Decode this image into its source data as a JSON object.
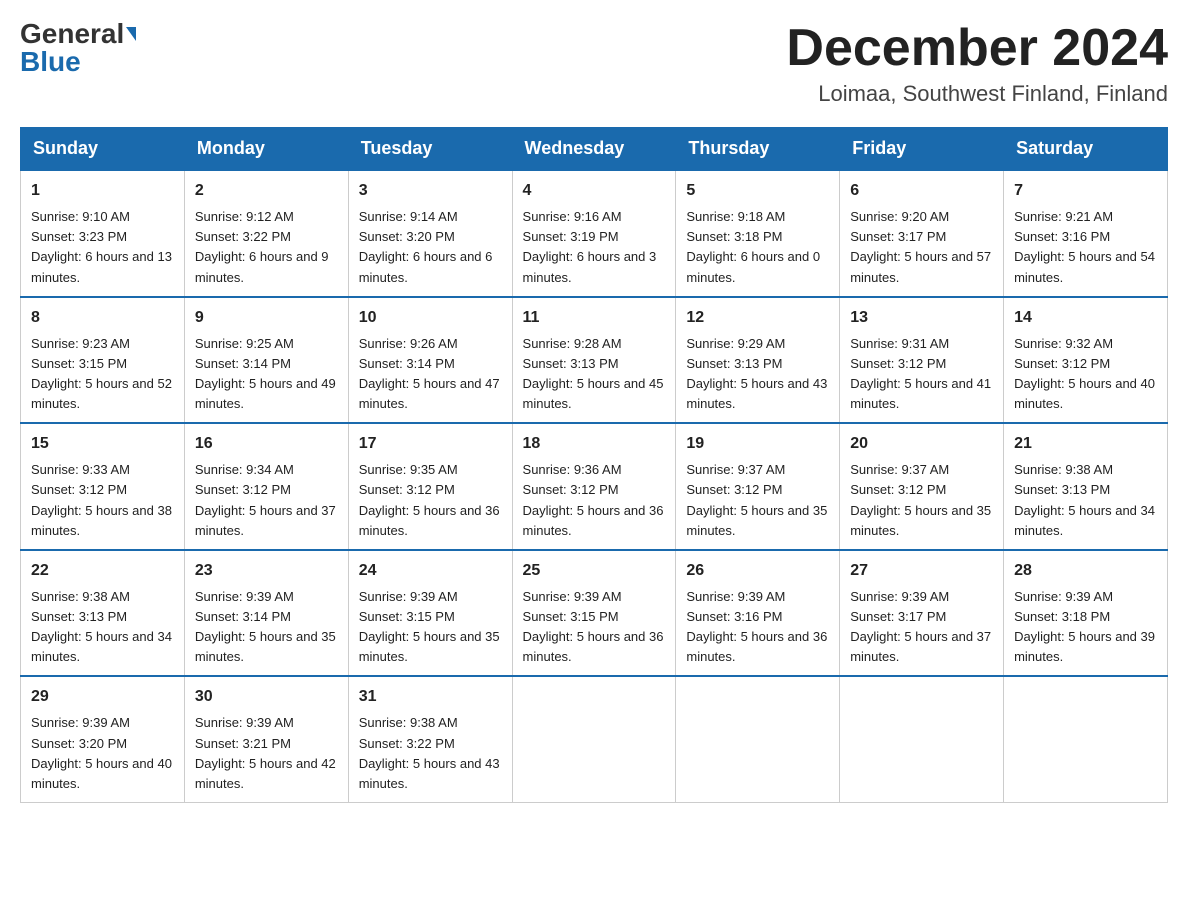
{
  "header": {
    "logo_general": "General",
    "logo_blue": "Blue",
    "month_title": "December 2024",
    "location": "Loimaa, Southwest Finland, Finland"
  },
  "weekdays": [
    "Sunday",
    "Monday",
    "Tuesday",
    "Wednesday",
    "Thursday",
    "Friday",
    "Saturday"
  ],
  "weeks": [
    [
      {
        "day": "1",
        "sunrise": "9:10 AM",
        "sunset": "3:23 PM",
        "daylight": "6 hours and 13 minutes."
      },
      {
        "day": "2",
        "sunrise": "9:12 AM",
        "sunset": "3:22 PM",
        "daylight": "6 hours and 9 minutes."
      },
      {
        "day": "3",
        "sunrise": "9:14 AM",
        "sunset": "3:20 PM",
        "daylight": "6 hours and 6 minutes."
      },
      {
        "day": "4",
        "sunrise": "9:16 AM",
        "sunset": "3:19 PM",
        "daylight": "6 hours and 3 minutes."
      },
      {
        "day": "5",
        "sunrise": "9:18 AM",
        "sunset": "3:18 PM",
        "daylight": "6 hours and 0 minutes."
      },
      {
        "day": "6",
        "sunrise": "9:20 AM",
        "sunset": "3:17 PM",
        "daylight": "5 hours and 57 minutes."
      },
      {
        "day": "7",
        "sunrise": "9:21 AM",
        "sunset": "3:16 PM",
        "daylight": "5 hours and 54 minutes."
      }
    ],
    [
      {
        "day": "8",
        "sunrise": "9:23 AM",
        "sunset": "3:15 PM",
        "daylight": "5 hours and 52 minutes."
      },
      {
        "day": "9",
        "sunrise": "9:25 AM",
        "sunset": "3:14 PM",
        "daylight": "5 hours and 49 minutes."
      },
      {
        "day": "10",
        "sunrise": "9:26 AM",
        "sunset": "3:14 PM",
        "daylight": "5 hours and 47 minutes."
      },
      {
        "day": "11",
        "sunrise": "9:28 AM",
        "sunset": "3:13 PM",
        "daylight": "5 hours and 45 minutes."
      },
      {
        "day": "12",
        "sunrise": "9:29 AM",
        "sunset": "3:13 PM",
        "daylight": "5 hours and 43 minutes."
      },
      {
        "day": "13",
        "sunrise": "9:31 AM",
        "sunset": "3:12 PM",
        "daylight": "5 hours and 41 minutes."
      },
      {
        "day": "14",
        "sunrise": "9:32 AM",
        "sunset": "3:12 PM",
        "daylight": "5 hours and 40 minutes."
      }
    ],
    [
      {
        "day": "15",
        "sunrise": "9:33 AM",
        "sunset": "3:12 PM",
        "daylight": "5 hours and 38 minutes."
      },
      {
        "day": "16",
        "sunrise": "9:34 AM",
        "sunset": "3:12 PM",
        "daylight": "5 hours and 37 minutes."
      },
      {
        "day": "17",
        "sunrise": "9:35 AM",
        "sunset": "3:12 PM",
        "daylight": "5 hours and 36 minutes."
      },
      {
        "day": "18",
        "sunrise": "9:36 AM",
        "sunset": "3:12 PM",
        "daylight": "5 hours and 36 minutes."
      },
      {
        "day": "19",
        "sunrise": "9:37 AM",
        "sunset": "3:12 PM",
        "daylight": "5 hours and 35 minutes."
      },
      {
        "day": "20",
        "sunrise": "9:37 AM",
        "sunset": "3:12 PM",
        "daylight": "5 hours and 35 minutes."
      },
      {
        "day": "21",
        "sunrise": "9:38 AM",
        "sunset": "3:13 PM",
        "daylight": "5 hours and 34 minutes."
      }
    ],
    [
      {
        "day": "22",
        "sunrise": "9:38 AM",
        "sunset": "3:13 PM",
        "daylight": "5 hours and 34 minutes."
      },
      {
        "day": "23",
        "sunrise": "9:39 AM",
        "sunset": "3:14 PM",
        "daylight": "5 hours and 35 minutes."
      },
      {
        "day": "24",
        "sunrise": "9:39 AM",
        "sunset": "3:15 PM",
        "daylight": "5 hours and 35 minutes."
      },
      {
        "day": "25",
        "sunrise": "9:39 AM",
        "sunset": "3:15 PM",
        "daylight": "5 hours and 36 minutes."
      },
      {
        "day": "26",
        "sunrise": "9:39 AM",
        "sunset": "3:16 PM",
        "daylight": "5 hours and 36 minutes."
      },
      {
        "day": "27",
        "sunrise": "9:39 AM",
        "sunset": "3:17 PM",
        "daylight": "5 hours and 37 minutes."
      },
      {
        "day": "28",
        "sunrise": "9:39 AM",
        "sunset": "3:18 PM",
        "daylight": "5 hours and 39 minutes."
      }
    ],
    [
      {
        "day": "29",
        "sunrise": "9:39 AM",
        "sunset": "3:20 PM",
        "daylight": "5 hours and 40 minutes."
      },
      {
        "day": "30",
        "sunrise": "9:39 AM",
        "sunset": "3:21 PM",
        "daylight": "5 hours and 42 minutes."
      },
      {
        "day": "31",
        "sunrise": "9:38 AM",
        "sunset": "3:22 PM",
        "daylight": "5 hours and 43 minutes."
      },
      null,
      null,
      null,
      null
    ]
  ]
}
